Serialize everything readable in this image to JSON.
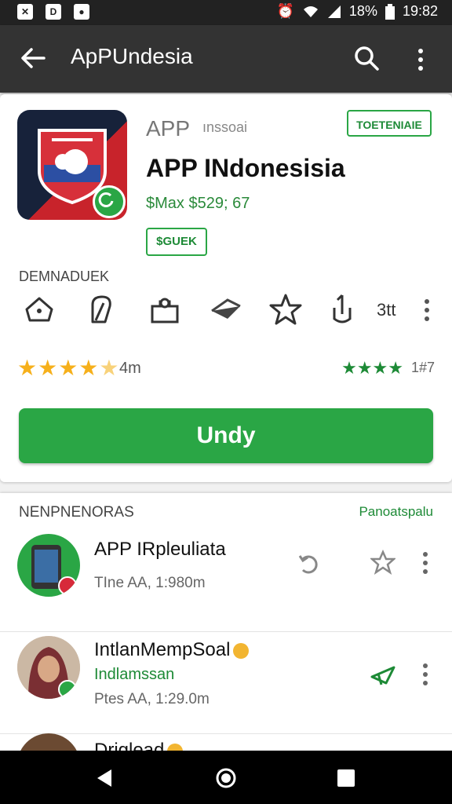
{
  "status_bar": {
    "battery": "18%",
    "time": "19:82"
  },
  "app_bar": {
    "title": "ApPUndesia"
  },
  "app": {
    "developer": "APP",
    "developer_sub": "ınssoai",
    "top_badge": "TOETENIAIE",
    "title": "APP INdonesisia",
    "price": "$Max $529; 67",
    "small_badge": "$GUEK",
    "section_label": "DEMNADUEK",
    "icon_count": "3tt",
    "rating_value": "4m",
    "rating_right": "1#7",
    "install_label": "Undу"
  },
  "list": {
    "header": "NENPNENORAS",
    "link": "Panoatspalu",
    "items": [
      {
        "name": "APP IRpleuliata",
        "sub": "",
        "meta": "TIne AA, 1:980m"
      },
      {
        "name": "IntlanMempSoal",
        "sub": "Indlamssan",
        "meta": "Ptes AA, 1:29.0m"
      },
      {
        "name": "Driglead",
        "sub": "",
        "meta": ""
      }
    ]
  },
  "colors": {
    "accent": "#2aa645",
    "appbar": "#333333",
    "star": "#f6b01b"
  }
}
